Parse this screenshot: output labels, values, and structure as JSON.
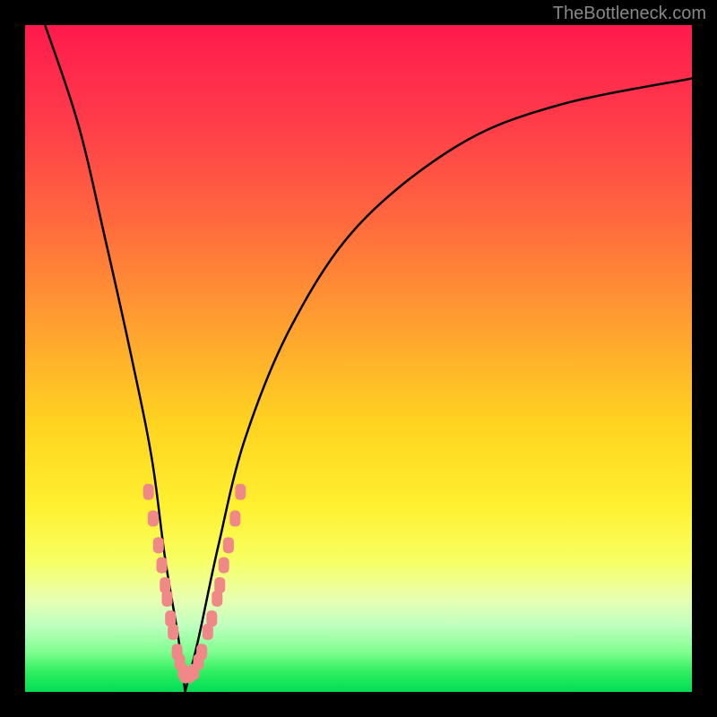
{
  "watermark": "TheBottleneck.com",
  "chart_data": {
    "type": "line",
    "title": "",
    "xlabel": "",
    "ylabel": "",
    "xlim": [
      0,
      100
    ],
    "ylim": [
      0,
      100
    ],
    "description": "Bottleneck V-curve showing performance mismatch percentage",
    "curve": {
      "type": "v-shape",
      "minimum_x": 24,
      "left_branch": [
        {
          "x": 3,
          "y": 100
        },
        {
          "x": 8,
          "y": 85
        },
        {
          "x": 12,
          "y": 68
        },
        {
          "x": 16,
          "y": 50
        },
        {
          "x": 19,
          "y": 35
        },
        {
          "x": 21,
          "y": 20
        },
        {
          "x": 23,
          "y": 8
        },
        {
          "x": 24,
          "y": 0
        }
      ],
      "right_branch": [
        {
          "x": 24,
          "y": 0
        },
        {
          "x": 26,
          "y": 8
        },
        {
          "x": 29,
          "y": 22
        },
        {
          "x": 33,
          "y": 38
        },
        {
          "x": 40,
          "y": 55
        },
        {
          "x": 50,
          "y": 70
        },
        {
          "x": 65,
          "y": 82
        },
        {
          "x": 80,
          "y": 88
        },
        {
          "x": 100,
          "y": 92
        }
      ]
    },
    "data_points": [
      {
        "x": 18.5,
        "y": 30
      },
      {
        "x": 19.2,
        "y": 26
      },
      {
        "x": 20.0,
        "y": 22
      },
      {
        "x": 20.5,
        "y": 19
      },
      {
        "x": 21.0,
        "y": 16
      },
      {
        "x": 21.3,
        "y": 14
      },
      {
        "x": 21.8,
        "y": 11
      },
      {
        "x": 22.2,
        "y": 9
      },
      {
        "x": 22.8,
        "y": 6
      },
      {
        "x": 23.2,
        "y": 4.5
      },
      {
        "x": 23.7,
        "y": 3
      },
      {
        "x": 24.0,
        "y": 2.5
      },
      {
        "x": 24.6,
        "y": 2.5
      },
      {
        "x": 25.3,
        "y": 3
      },
      {
        "x": 26.0,
        "y": 4.5
      },
      {
        "x": 26.5,
        "y": 6
      },
      {
        "x": 27.4,
        "y": 9
      },
      {
        "x": 28.0,
        "y": 11
      },
      {
        "x": 28.8,
        "y": 14
      },
      {
        "x": 29.2,
        "y": 16
      },
      {
        "x": 29.8,
        "y": 19
      },
      {
        "x": 30.5,
        "y": 22
      },
      {
        "x": 31.5,
        "y": 26
      },
      {
        "x": 32.3,
        "y": 30
      }
    ],
    "gradient_stops": [
      {
        "offset": 0,
        "color": "#ff1a4d"
      },
      {
        "offset": 15,
        "color": "#ff3d4a"
      },
      {
        "offset": 30,
        "color": "#ff6b3d"
      },
      {
        "offset": 45,
        "color": "#ffa030"
      },
      {
        "offset": 60,
        "color": "#ffd420"
      },
      {
        "offset": 72,
        "color": "#fff030"
      },
      {
        "offset": 80,
        "color": "#f8ff60"
      },
      {
        "offset": 86,
        "color": "#e8ffb0"
      },
      {
        "offset": 90,
        "color": "#c0ffc0"
      },
      {
        "offset": 94,
        "color": "#80ff90"
      },
      {
        "offset": 97,
        "color": "#30ee60"
      },
      {
        "offset": 100,
        "color": "#00dd55"
      }
    ],
    "point_color": "#f08888",
    "curve_color": "#000000"
  }
}
